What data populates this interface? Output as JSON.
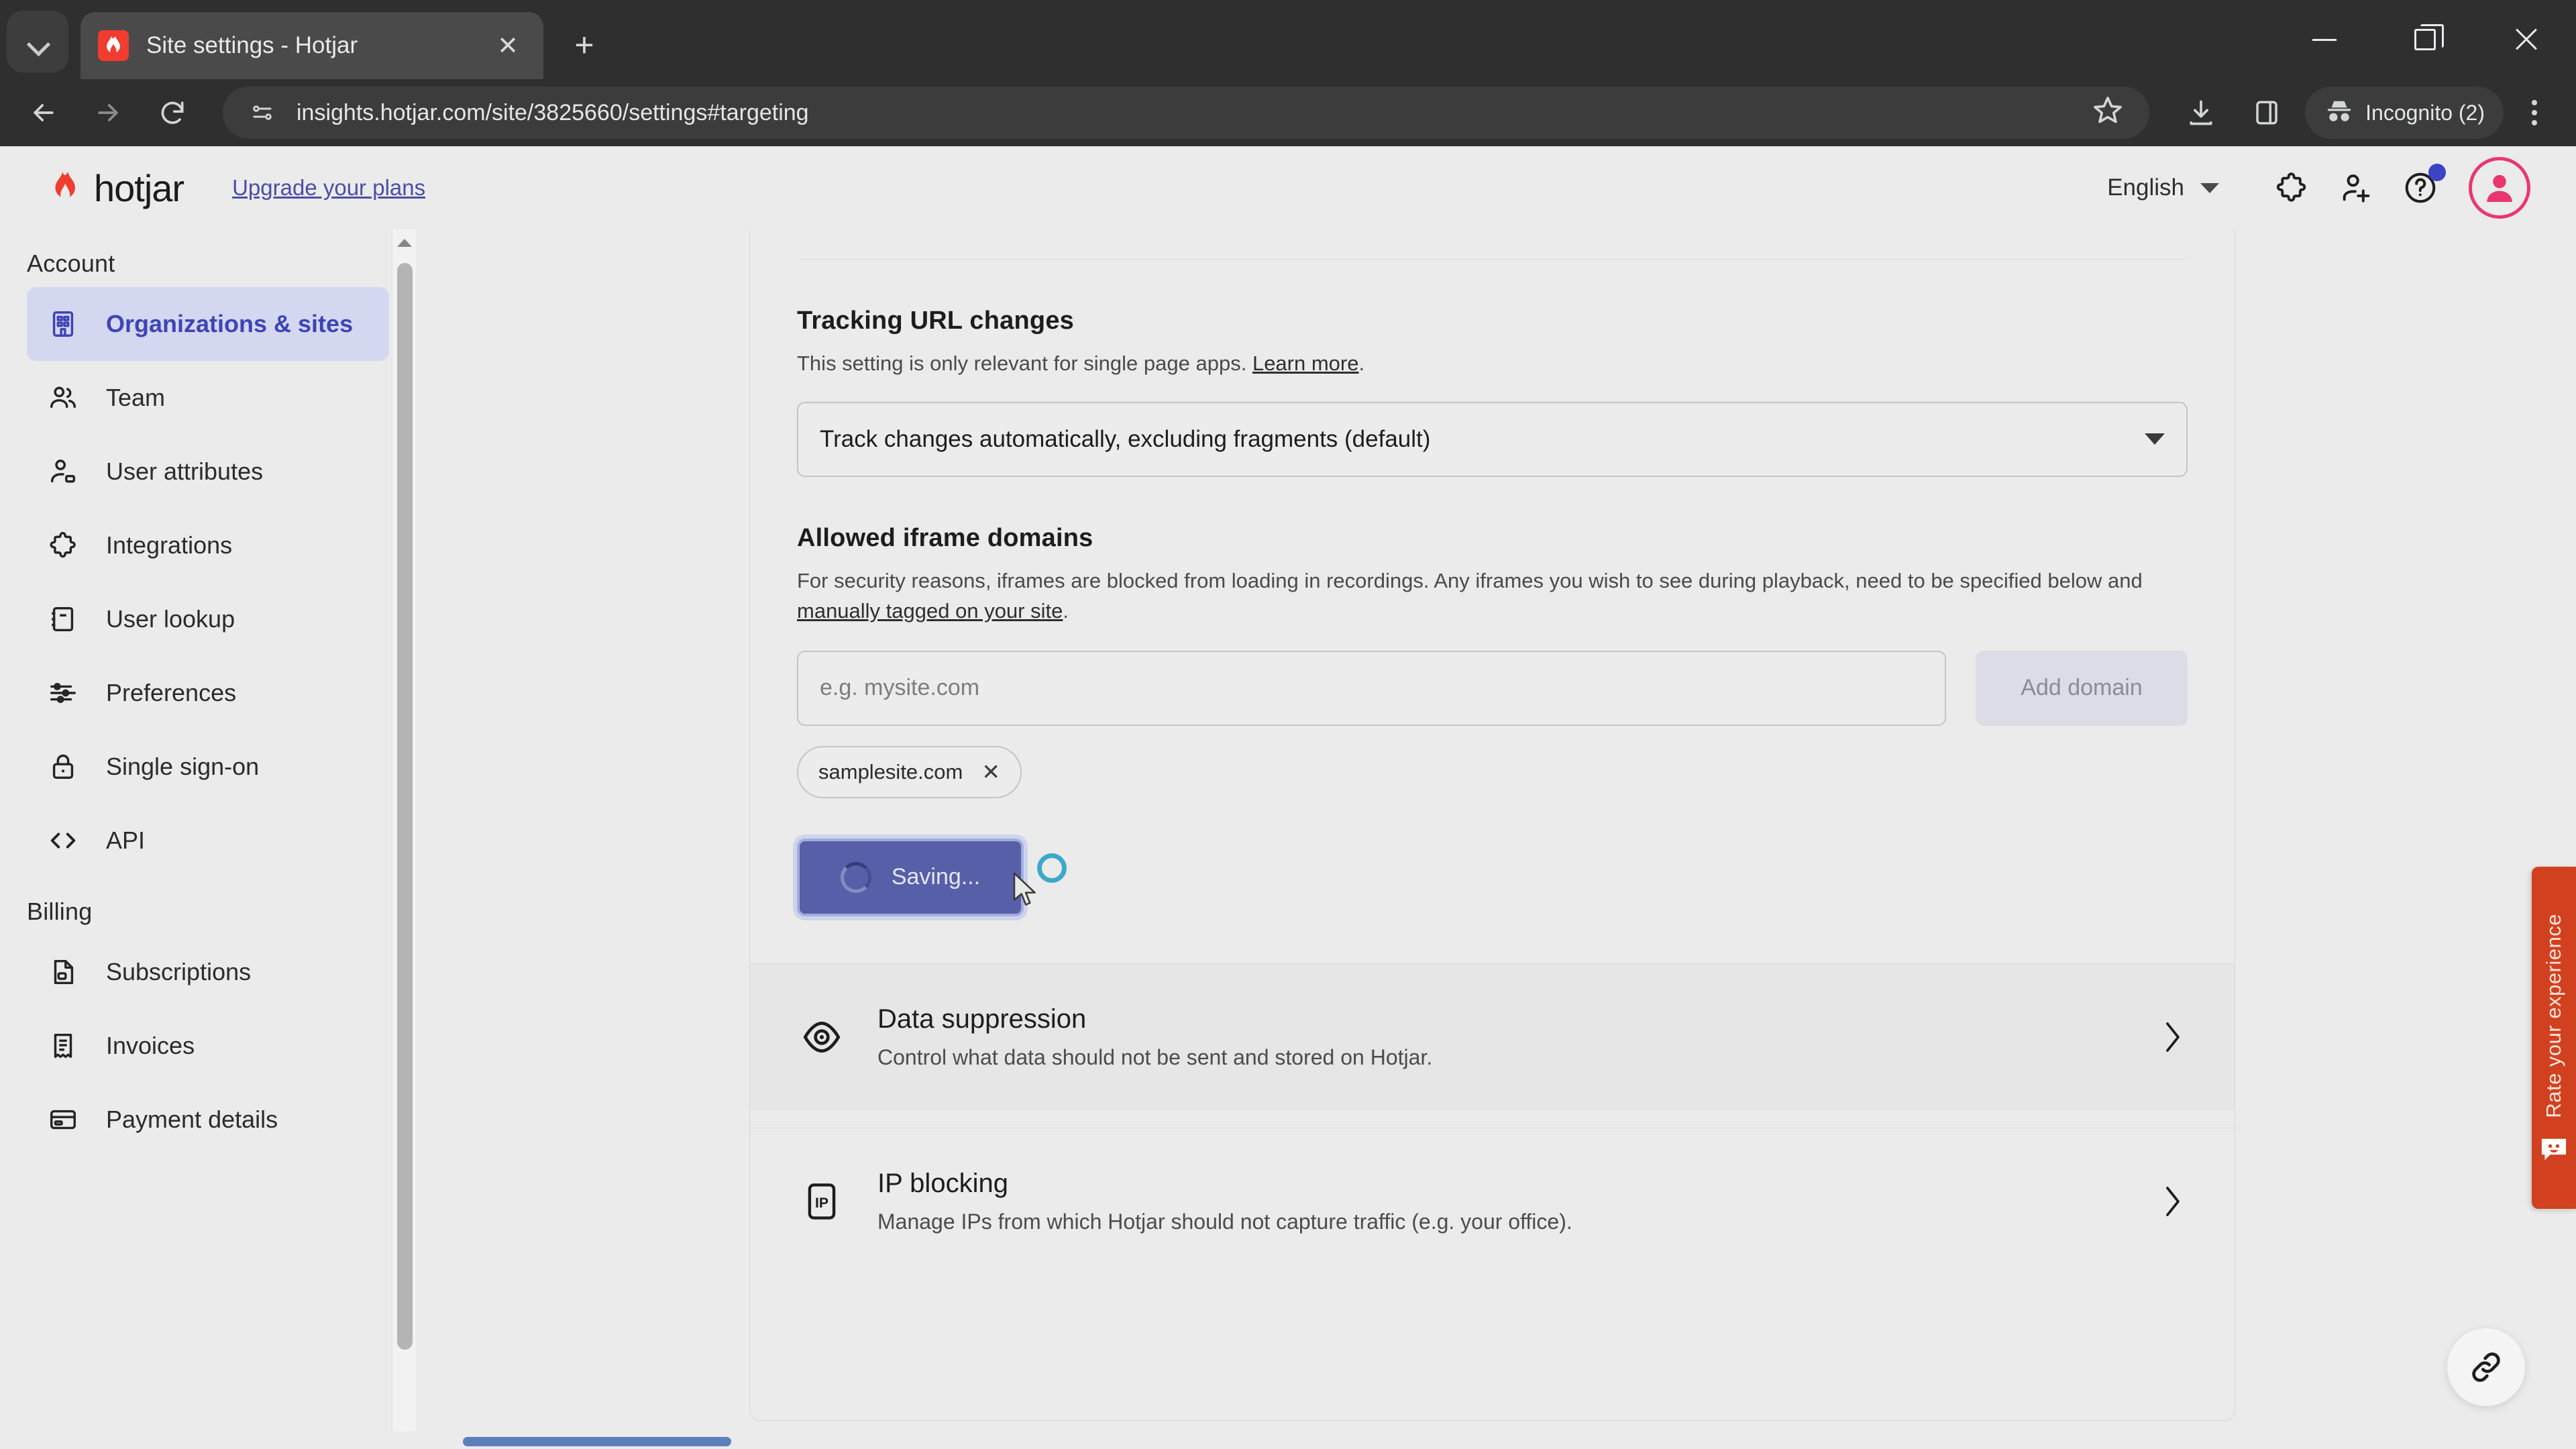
{
  "browser": {
    "tab": {
      "title": "Site settings - Hotjar",
      "favicon": "hotjar-flame-icon",
      "close_icon": "close-icon"
    },
    "tab_list_icon": "chevron-down-icon",
    "new_tab_icon": "plus-icon",
    "window_controls": {
      "minimize": "minimize-icon",
      "maximize": "maximize-icon",
      "close": "close-icon"
    },
    "nav": {
      "back": "back-arrow-icon",
      "forward": "forward-arrow-icon",
      "reload": "reload-icon"
    },
    "omnibox": {
      "site_icon": "site-settings-icon",
      "url": "insights.hotjar.com/site/3825660/settings#targeting",
      "bookmark_icon": "star-icon"
    },
    "toolbar": {
      "downloads_icon": "download-icon",
      "side_panel_icon": "side-panel-icon",
      "incognito_icon": "incognito-icon",
      "incognito_label": "Incognito (2)",
      "menu_icon": "kebab-menu-icon"
    }
  },
  "app_header": {
    "logo_icon": "hotjar-flame-icon",
    "wordmark": "hotjar",
    "upgrade_link": "Upgrade your plans",
    "language": "English",
    "language_caret_icon": "chevron-down-icon",
    "integrations_icon": "puzzle-piece-icon",
    "invite_icon": "add-user-icon",
    "help_icon": "question-mark-circle-icon",
    "avatar_icon": "user-avatar-icon"
  },
  "sidebar": {
    "groups": [
      {
        "title": "Account",
        "items": [
          {
            "label": "Organizations & sites",
            "icon": "building-icon",
            "active": true
          },
          {
            "label": "Team",
            "icon": "people-icon",
            "active": false
          },
          {
            "label": "User attributes",
            "icon": "user-tag-icon",
            "active": false
          },
          {
            "label": "Integrations",
            "icon": "puzzle-piece-icon",
            "active": false
          },
          {
            "label": "User lookup",
            "icon": "notebook-icon",
            "active": false
          },
          {
            "label": "Preferences",
            "icon": "sliders-icon",
            "active": false
          },
          {
            "label": "Single sign-on",
            "icon": "lock-icon",
            "active": false
          },
          {
            "label": "API",
            "icon": "code-brackets-icon",
            "active": false
          }
        ]
      },
      {
        "title": "Billing",
        "items": [
          {
            "label": "Subscriptions",
            "icon": "document-subscription-icon",
            "active": false
          },
          {
            "label": "Invoices",
            "icon": "receipt-icon",
            "active": false
          },
          {
            "label": "Payment details",
            "icon": "credit-card-icon",
            "active": false
          }
        ]
      }
    ],
    "scroll_up_icon": "scroll-up-arrow-icon",
    "scroll_down_icon": "scroll-down-arrow-icon"
  },
  "main": {
    "tracking_url": {
      "title": "Tracking URL changes",
      "description": "This setting is only relevant for single page apps.",
      "learn_more": "Learn more",
      "description_end": ".",
      "selected_option": "Track changes automatically, excluding fragments (default)",
      "caret_icon": "chevron-down-icon"
    },
    "iframe_domains": {
      "title": "Allowed iframe domains",
      "description_part1": "For security reasons, iframes are blocked from loading in recordings. Any iframes you wish to see during playback, need to be specified below and ",
      "description_link": "manually tagged on your site",
      "description_part2": ".",
      "input_placeholder": "e.g. mysite.com",
      "input_value": "",
      "add_button": "Add domain",
      "chips": [
        {
          "label": "samplesite.com",
          "remove_icon": "close-icon"
        }
      ]
    },
    "save_button": {
      "label": "Saving...",
      "state": "saving",
      "spinner_icon": "loading-spinner-icon",
      "ripple_color": "#1f9ec4"
    },
    "rows": [
      {
        "title": "Data suppression",
        "subtitle": "Control what data should not be sent and stored on Hotjar.",
        "icon": "eye-icon",
        "chevron_icon": "chevron-right-icon",
        "highlighted": true
      },
      {
        "title": "IP blocking",
        "subtitle": "Manage IPs from which Hotjar should not capture traffic (e.g. your office).",
        "icon": "ip-badge-icon",
        "chevron_icon": "chevron-right-icon",
        "highlighted": false
      }
    ]
  },
  "feedback_widget": {
    "label": "Rate your experience",
    "icon": "smiley-feedback-icon",
    "color": "#d1411f"
  },
  "link_fab": {
    "icon": "link-chain-icon"
  },
  "colors": {
    "accent": "#4b4ea8",
    "hotjar_red": "#f03d2f",
    "active_nav_bg": "#d3d8f0",
    "save_button": "#575fa8",
    "page_bg": "#ebebeb",
    "chrome_bg": "#2f2f2f"
  }
}
